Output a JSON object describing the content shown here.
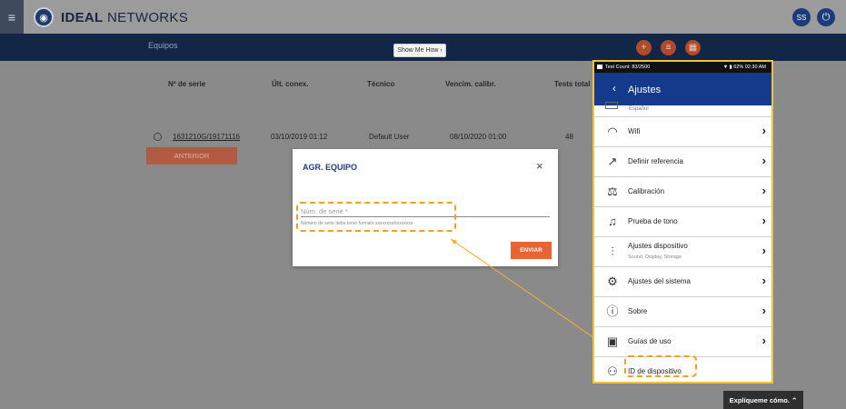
{
  "app": {
    "brand_bold": "IDEAL",
    "brand_rest": " NETWORKS",
    "menu_icon": "≡",
    "avatar_initials": "SS",
    "power_icon": "⏻"
  },
  "section": {
    "title": "Equipos",
    "howto": "Show Me How ›"
  },
  "fabs": [
    "+",
    "≡",
    "▦"
  ],
  "table": {
    "headers": [
      "Nº de serie",
      "Últ. conex.",
      "Técnico",
      "Vencim. calibr.",
      "Tests total"
    ],
    "rows": [
      {
        "serial": "1631210G/19171116",
        "last_conn": "03/10/2019 01:12",
        "tech": "Default User",
        "cal_due": "08/10/2020 01:00",
        "tests": "48"
      }
    ],
    "prev_label": "ANTERIOR"
  },
  "dialog": {
    "title": "AGR. EQUIPO",
    "close": "×",
    "field_placeholder": "Núm. de serie *",
    "field_help": "Número de serie debe tener formato xxxxxxxx/xxxxxxxx",
    "submit": "ENVIAR"
  },
  "phone": {
    "status_left": "Test Count: 83/2500",
    "status_right": "▼ ▮ 62% 02:30 AM",
    "back": "‹",
    "title": "Ajustes",
    "partial_label": "Español",
    "items": [
      {
        "label": "Wifi",
        "icon": "wifi-icon",
        "glyph": "◠",
        "chevron": true
      },
      {
        "label": "Definir referencia",
        "icon": "reference-icon",
        "glyph": "↗",
        "chevron": true
      },
      {
        "label": "Calibración",
        "icon": "calibration-icon",
        "glyph": "⚖",
        "chevron": true
      },
      {
        "label": "Prueba de tono",
        "icon": "tone-icon",
        "glyph": "♫",
        "chevron": true
      },
      {
        "label": "Ajustes dispositivo",
        "sub": "Sound, Display, Storage",
        "icon": "device-settings-icon",
        "glyph": "⫶",
        "chevron": true
      },
      {
        "label": "Ajustes del sistema",
        "icon": "system-settings-icon",
        "glyph": "⚙",
        "chevron": true
      },
      {
        "label": "Sobre",
        "icon": "info-icon",
        "glyph": "ⓘ",
        "chevron": true
      },
      {
        "label": "Guías de uso",
        "icon": "guide-icon",
        "glyph": "▣",
        "chevron": true
      },
      {
        "label": "ID de dispositivo",
        "icon": "device-id-icon",
        "glyph": "⚇",
        "chevron": false
      }
    ],
    "chevron": "›"
  },
  "explique": "Explíqueme cómo. ⌃",
  "colors": {
    "navy": "#122748",
    "accent": "#e86434",
    "highlight": "#f0a020"
  }
}
